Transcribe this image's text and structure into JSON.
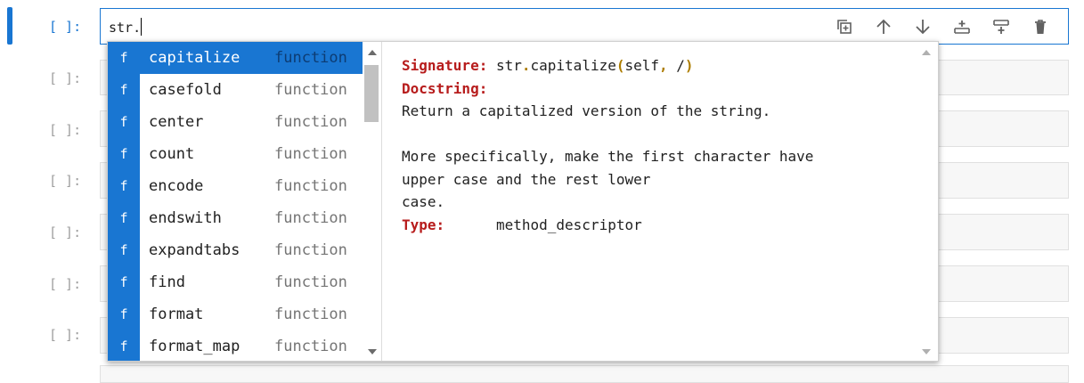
{
  "active_cell": {
    "prompt": "[ ]:",
    "code": "str."
  },
  "inactive_prompts": [
    "[ ]:",
    "[ ]:",
    "[ ]:",
    "[ ]:",
    "[ ]:",
    "[ ]:"
  ],
  "toolbar_icons": [
    "duplicate-cell-icon",
    "move-up-icon",
    "move-down-icon",
    "insert-above-icon",
    "insert-below-icon",
    "delete-icon"
  ],
  "completer": {
    "items": [
      {
        "badge": "f",
        "name": "capitalize",
        "kind": "function",
        "selected": true
      },
      {
        "badge": "f",
        "name": "casefold",
        "kind": "function"
      },
      {
        "badge": "f",
        "name": "center",
        "kind": "function"
      },
      {
        "badge": "f",
        "name": "count",
        "kind": "function"
      },
      {
        "badge": "f",
        "name": "encode",
        "kind": "function"
      },
      {
        "badge": "f",
        "name": "endswith",
        "kind": "function"
      },
      {
        "badge": "f",
        "name": "expandtabs",
        "kind": "function"
      },
      {
        "badge": "f",
        "name": "find",
        "kind": "function"
      },
      {
        "badge": "f",
        "name": "format",
        "kind": "function"
      },
      {
        "badge": "f",
        "name": "format_map",
        "kind": "function"
      }
    ],
    "doc": {
      "signature_label": "Signature:",
      "signature_prefix": "str",
      "signature_dot": ".",
      "signature_func": "capitalize",
      "signature_open": "(",
      "signature_args_a": "self",
      "signature_comma": ",",
      "signature_args_b": " /",
      "signature_close": ")",
      "docstring_label": "Docstring:",
      "doc_lines": [
        "Return a capitalized version of the string.",
        "",
        "More specifically, make the first character have",
        "upper case and the rest lower",
        "case."
      ],
      "type_label": "Type:",
      "type_value": "method_descriptor"
    }
  },
  "colors": {
    "accent": "#1976d2",
    "keyword": "#b71c1c",
    "paren": "#ad7d00"
  }
}
